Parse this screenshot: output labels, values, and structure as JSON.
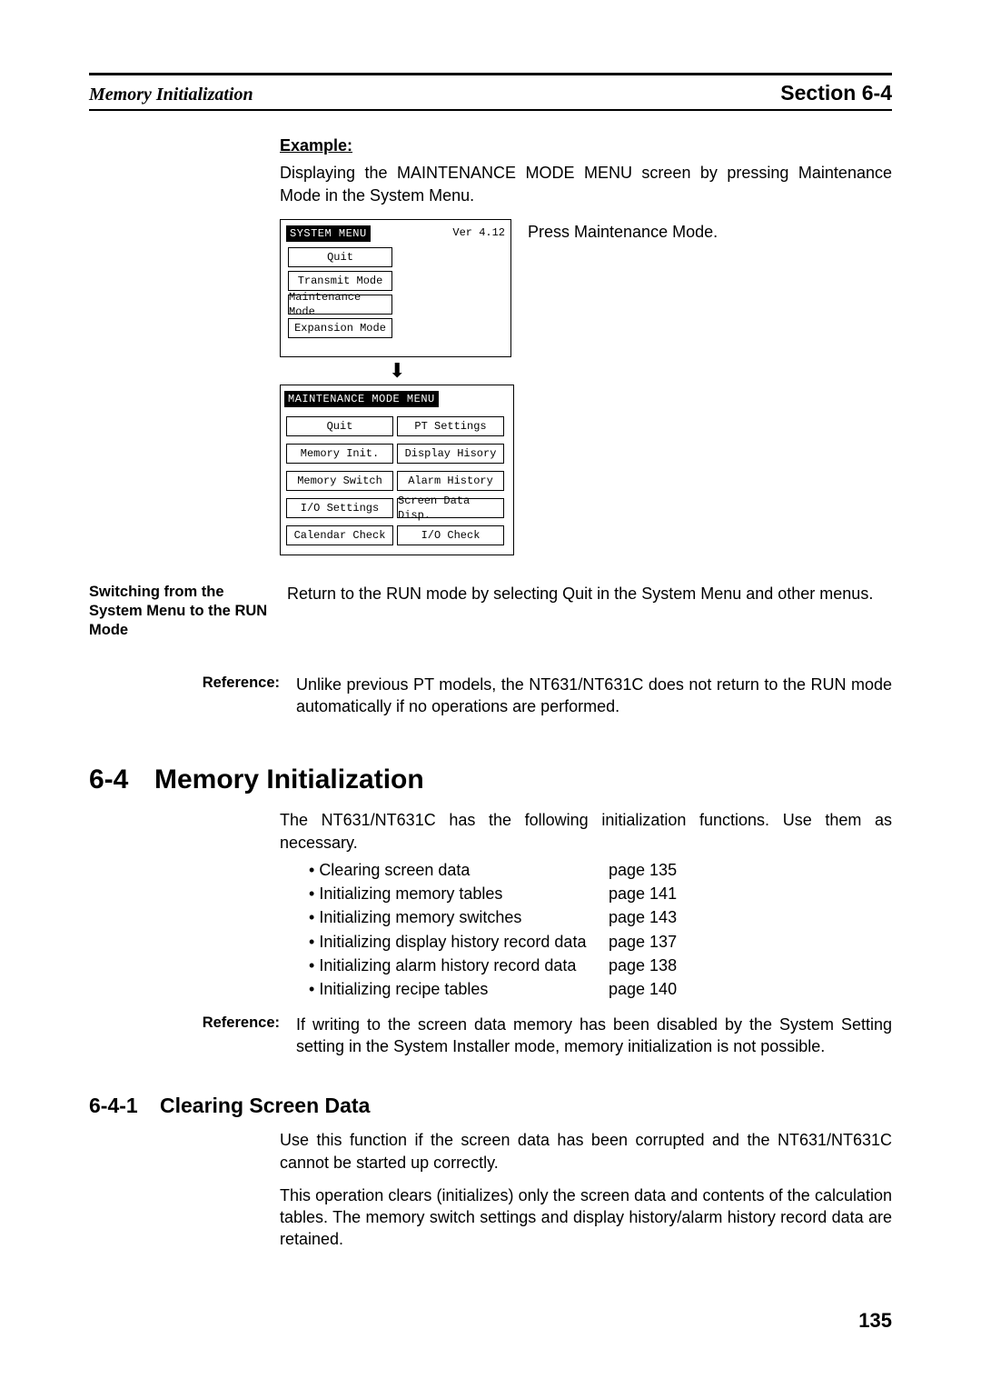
{
  "header": {
    "left": "Memory Initialization",
    "right": "Section 6-4"
  },
  "example": {
    "heading": "Example:",
    "body": "Displaying the MAINTENANCE MODE MENU screen by pressing Maintenance Mode in the System Menu.",
    "press": "Press Maintenance Mode."
  },
  "system_menu": {
    "title": "SYSTEM MENU",
    "version": "Ver 4.12",
    "buttons": [
      "Quit",
      "Transmit Mode",
      "Maintenance Mode",
      "Expansion Mode"
    ]
  },
  "maint_menu": {
    "title": "MAINTENANCE MODE MENU",
    "left": [
      "Quit",
      "Memory Init.",
      "Memory Switch",
      "I/O Settings",
      "Calendar Check"
    ],
    "right": [
      "PT Settings",
      "Display Hisory",
      "Alarm History",
      "Screen Data Disp.",
      "I/O Check"
    ]
  },
  "switching": {
    "label": "Switching from the System Menu to the RUN Mode",
    "body": "Return to the RUN mode by selecting Quit in the System Menu and other menus."
  },
  "reference1": {
    "label": "Reference:",
    "body": "Unlike previous PT models, the NT631/NT631C does not return to the RUN mode automatically if no operations are performed."
  },
  "section64": {
    "num": "6-4",
    "title": "Memory Initialization",
    "intro": "The NT631/NT631C has the following initialization functions. Use them as necessary.",
    "bullets": [
      {
        "txt": "Clearing screen data",
        "page": "page 135"
      },
      {
        "txt": "Initializing memory tables",
        "page": "page 141"
      },
      {
        "txt": "Initializing memory switches",
        "page": "page 143"
      },
      {
        "txt": "Initializing display history record data",
        "page": "page 137"
      },
      {
        "txt": "Initializing alarm history record data",
        "page": "page 138"
      },
      {
        "txt": "Initializing recipe tables",
        "page": "page 140"
      }
    ]
  },
  "reference2": {
    "label": "Reference:",
    "body": "If writing to the screen data memory has been disabled by the System Setting setting in the System Installer mode, memory initialization is not possible."
  },
  "section641": {
    "num": "6-4-1",
    "title": "Clearing Screen Data",
    "p1": "Use this function if the screen data has been corrupted and the NT631/NT631C cannot be started up correctly.",
    "p2": "This operation clears (initializes) only the screen data and contents of the calculation tables. The memory switch settings and display history/alarm history record data are retained."
  },
  "page_number": "135"
}
